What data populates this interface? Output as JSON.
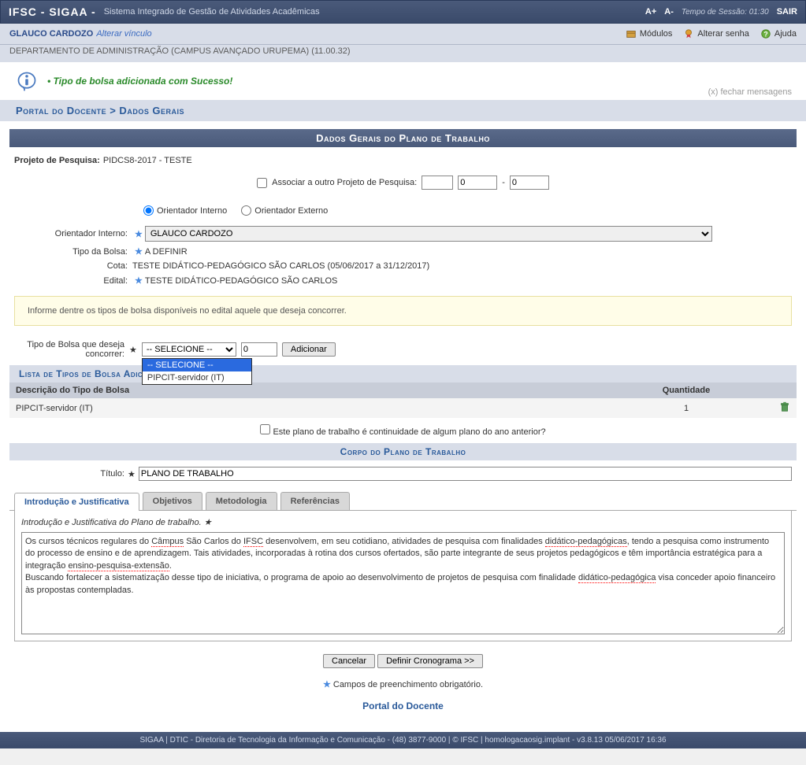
{
  "header": {
    "sys_short": "IFSC - SIGAA -",
    "sys_full": "Sistema Integrado de Gestão de Atividades Acadêmicas",
    "font_plus": "A+",
    "font_minus": "A-",
    "session_label": "Tempo de Sessão:",
    "session_time": "01:30",
    "exit": "SAIR"
  },
  "user": {
    "name": "GLAUCO CARDOZO",
    "link": "Alterar vínculo",
    "dept": "DEPARTAMENTO DE ADMINISTRAÇÃO (CAMPUS AVANÇADO URUPEMA) (11.00.32)",
    "actions": {
      "modulos": "Módulos",
      "senha": "Alterar senha",
      "ajuda": "Ajuda"
    }
  },
  "message": {
    "bullet": "•",
    "text": "Tipo de bolsa adicionada com Sucesso!",
    "close": "(x) fechar mensagens"
  },
  "breadcrumb": "Portal do Docente > Dados Gerais",
  "section_title": "Dados Gerais do Plano de Trabalho",
  "projeto": {
    "label": "Projeto de Pesquisa:",
    "value": "PIDCS8-2017 - TESTE"
  },
  "assoc": {
    "label": "Associar a outro Projeto de Pesquisa:",
    "v1": "",
    "v2": "0",
    "sep": "-",
    "v3": "0"
  },
  "orient_radio": {
    "interno": "Orientador Interno",
    "externo": "Orientador Externo"
  },
  "orient_interno": {
    "label": "Orientador Interno:",
    "value": "GLAUCO CARDOZO"
  },
  "tipo_bolsa": {
    "label": "Tipo da Bolsa:",
    "value": "A DEFINIR"
  },
  "cota": {
    "label": "Cota:",
    "value": "TESTE DIDÁTICO-PEDAGÓGICO SÃO CARLOS (05/06/2017 a 31/12/2017)"
  },
  "edital": {
    "label": "Edital:",
    "value": "TESTE DIDÁTICO-PEDAGÓGICO SÃO CARLOS"
  },
  "info_text": "Informe dentre os tipos de bolsa disponíveis no edital aquele que deseja concorrer.",
  "tipo_concorrer": {
    "label": "Tipo de Bolsa que deseja concorrer:",
    "selected": "-- SELECIONE --",
    "options": [
      "-- SELECIONE --",
      "PIPCIT-servidor (IT)"
    ],
    "qty": "0",
    "btn": "Adicionar"
  },
  "lista_hdr": "Lista de Tipos de Bolsa Adicionadas",
  "table": {
    "col_desc": "Descrição do Tipo de Bolsa",
    "col_qty": "Quantidade",
    "rows": [
      {
        "desc": "PIPCIT-servidor (IT)",
        "qty": "1"
      }
    ]
  },
  "continuidade": "Este plano de trabalho é continuidade de algum plano do ano anterior?",
  "corpo_hdr": "Corpo do Plano de Trabalho",
  "titulo": {
    "label": "Título:",
    "value": "PLANO DE TRABALHO"
  },
  "tabs": {
    "t1": "Introdução e Justificativa",
    "t2": "Objetivos",
    "t3": "Metodologia",
    "t4": "Referências"
  },
  "tab_sub": "Introdução e Justificativa do Plano de trabalho.",
  "textarea_parts": {
    "p1": "Os cursos técnicos regulares do ",
    "u1": "Câmpus",
    "p2": " São Carlos do ",
    "u2": "IFSC",
    "p3": " desenvolvem, em seu cotidiano, atividades de pesquisa com finalidades ",
    "u3": "didático-pedagógicas",
    "p4": ", tendo a pesquisa como instrumento do processo de ensino e de aprendizagem. Tais atividades, incorporadas à rotina dos cursos ofertados, são parte integrante de seus projetos pedagógicos e têm importância estratégica para a integração ",
    "u4": "ensino-pesquisa-extensão",
    "p5": ".",
    "p6": "Buscando fortalecer a sistematização desse tipo de iniciativa, o programa de apoio ao desenvolvimento de projetos de pesquisa com finalidade ",
    "u5": "didático-pedagógica",
    "p7": " visa conceder apoio financeiro às propostas contempladas."
  },
  "buttons": {
    "cancelar": "Cancelar",
    "cronograma": "Definir Cronograma >>"
  },
  "req_note": "Campos de preenchimento obrigatório.",
  "portal_link": "Portal do Docente",
  "footer": "SIGAA | DTIC - Diretoria de Tecnologia da Informação e Comunicação - (48) 3877-9000 | © IFSC | homologacaosig.implant - v3.8.13 05/06/2017 16:36"
}
